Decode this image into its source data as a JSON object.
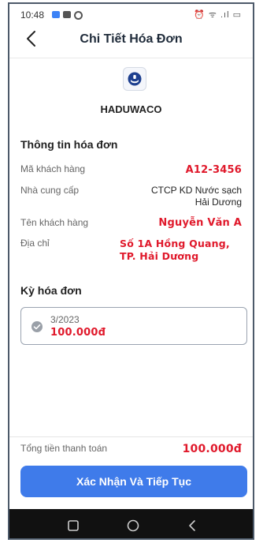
{
  "status_bar": {
    "time": "10:48",
    "right_icons": "⏰ ᯤ .ıl ▭"
  },
  "header": {
    "title": "Chi Tiết Hóa Đơn",
    "back_icon": "chevron-left-icon"
  },
  "company": {
    "name": "HADUWACO",
    "logo_icon": "company-logo-icon"
  },
  "invoice_info": {
    "section_title": "Thông tin hóa đơn",
    "rows": [
      {
        "label": "Mã khách hàng",
        "value": "A12-3456"
      },
      {
        "label": "Nhà cung cấp",
        "value": "CTCP KD Nước sạch Hải Dương"
      },
      {
        "label": "Tên khách hàng",
        "value": "Nguyễn Văn A"
      },
      {
        "label": "Địa chỉ",
        "value": "Số 1A Hồng Quang, TP. Hải Dương"
      }
    ]
  },
  "period": {
    "section_title": "Kỳ hóa đơn",
    "month": "3/2023",
    "amount": "100.000đ"
  },
  "total": {
    "label": "Tổng tiền thanh toán",
    "value": "100.000đ"
  },
  "cta": {
    "label": "Xác Nhận Và Tiếp Tục"
  },
  "colors": {
    "accent": "#3f7bea",
    "highlight_red": "#e0192b",
    "nav_bar": "#111111"
  }
}
